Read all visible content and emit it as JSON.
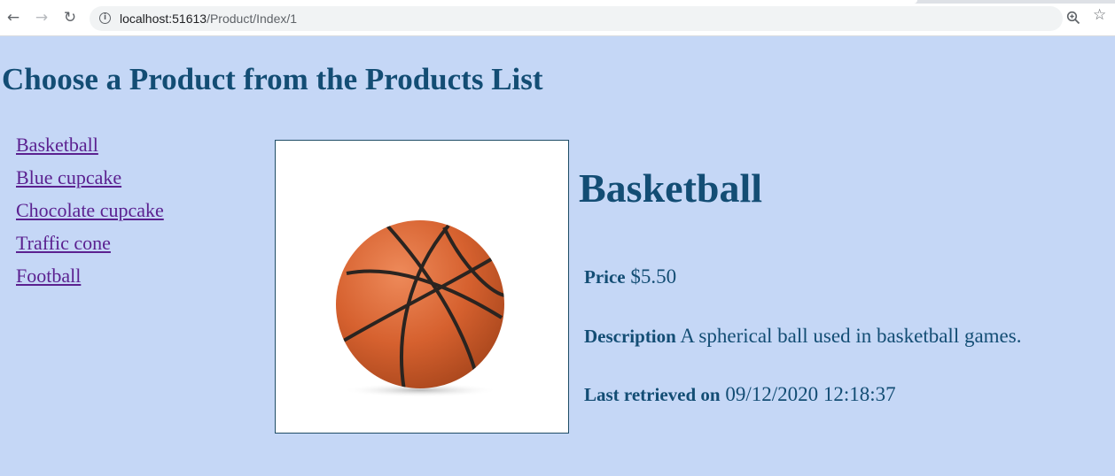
{
  "browser": {
    "back_icon": "←",
    "forward_icon": "→",
    "reload_icon": "↻",
    "info_icon": "i",
    "star_icon": "☆",
    "url_host": "localhost:51613",
    "url_path": "/Product/Index/1"
  },
  "page": {
    "title": "Choose a Product from the Products List"
  },
  "products": [
    {
      "label": "Basketball"
    },
    {
      "label": "Blue cupcake"
    },
    {
      "label": "Chocolate cupcake"
    },
    {
      "label": "Traffic cone"
    },
    {
      "label": "Football"
    }
  ],
  "detail": {
    "name": "Basketball",
    "price_label": "Price",
    "price_value": "$5.50",
    "description_label": "Description",
    "description_value": "A spherical ball used in basketball games.",
    "retrieved_label": "Last retrieved on",
    "retrieved_value": "09/12/2020 12:18:37"
  },
  "colors": {
    "page_background": "#c5d7f6",
    "heading": "#134d74",
    "link": "#5b2190",
    "ball": "#d9693a"
  }
}
